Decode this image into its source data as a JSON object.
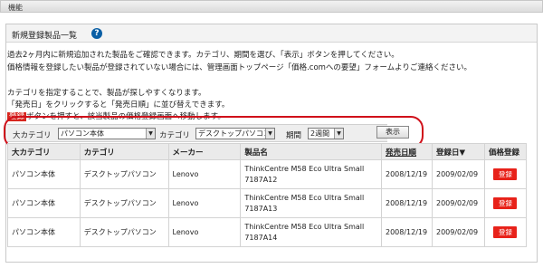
{
  "header": {
    "title": "機能"
  },
  "panel": {
    "title": "新規登録製品一覧",
    "help_glyph": "?",
    "desc_lines": [
      "過去2ヶ月内に新規追加された製品をご確認できます。カテゴリ、期間を選び、「表示」ボタンを押してください。",
      "価格情報を登録したい製品が登録されていない場合には、管理画面トップページ「価格.comへの要望」フォームよりご連絡ください。",
      "",
      "カテゴリを指定することで、製品が探しやすくなります。",
      "「発売日」をクリックすると「発売日順」に並び替えできます。"
    ],
    "desc_last_tag": "登録",
    "desc_last_rest": "ボタンを押すと、該当製品の価格登録画面へ移動します。"
  },
  "filter": {
    "big_category_label": "大カテゴリ",
    "big_category_value": "パソコン本体",
    "category_label": "カテゴリ",
    "category_value": "デスクトップパソコン",
    "period_label": "期間",
    "period_value": "2週間",
    "show_button": "表示"
  },
  "table": {
    "headers": [
      "大カテゴリ",
      "カテゴリ",
      "メーカー",
      "製品名",
      "発売日順",
      "登録日▼",
      "価格登録"
    ],
    "rows": [
      {
        "big": "パソコン本体",
        "cat": "デスクトップパソコン",
        "maker": "Lenovo",
        "name1": "ThinkCentre M58 Eco Ultra Small",
        "name2": "7187A12",
        "release": "2008/12/19",
        "registered": "2009/02/09",
        "action": "登録"
      },
      {
        "big": "パソコン本体",
        "cat": "デスクトップパソコン",
        "maker": "Lenovo",
        "name1": "ThinkCentre M58 Eco Ultra Small",
        "name2": "7187A13",
        "release": "2008/12/19",
        "registered": "2009/02/09",
        "action": "登録"
      },
      {
        "big": "パソコン本体",
        "cat": "デスクトップパソコン",
        "maker": "Lenovo",
        "name1": "ThinkCentre M58 Eco Ultra Small",
        "name2": "7187A14",
        "release": "2008/12/19",
        "registered": "2009/02/09",
        "action": "登録"
      }
    ]
  },
  "colors": {
    "accent_red": "#d0101a",
    "link_blue": "#1a3fbf",
    "button_red": "#e8221a"
  }
}
